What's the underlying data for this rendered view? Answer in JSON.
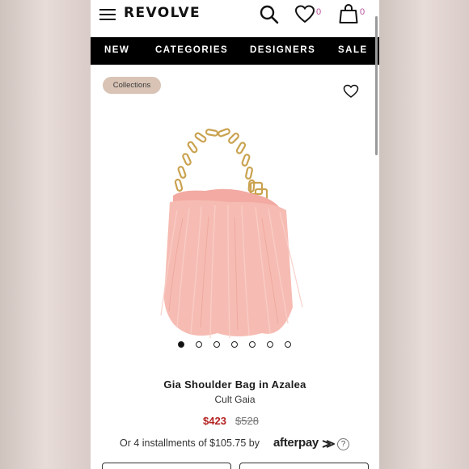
{
  "header": {
    "brand": "REVOLVE",
    "wishlist_count": "0",
    "bag_count": "0"
  },
  "nav": {
    "items": [
      "NEW",
      "CATEGORIES",
      "DESIGNERS",
      "SALE"
    ]
  },
  "product": {
    "collection_badge": "Collections",
    "name": "Gia Shoulder Bag in Azalea",
    "designer": "Cult Gaia",
    "sale_price": "$423",
    "original_price": "$528",
    "installments_text": "Or 4 installments of $105.75 by",
    "afterpay_label": "afterpay",
    "help_glyph": "?",
    "image_count": 7,
    "active_image_index": 0
  },
  "colors": {
    "nav_bg": "#000000",
    "sale_price": "#b32121",
    "badge_bg": "#d8c3b5",
    "count_accent": "#b6509b",
    "feather_pink": "#f4b6ad"
  },
  "icons": {
    "menu": "hamburger-icon",
    "search": "search-icon",
    "wishlist": "heart-icon",
    "bag": "shopping-bag-icon",
    "favorite": "heart-outline-icon",
    "afterpay": "afterpay-arrows-icon",
    "help": "help-circle-icon"
  }
}
